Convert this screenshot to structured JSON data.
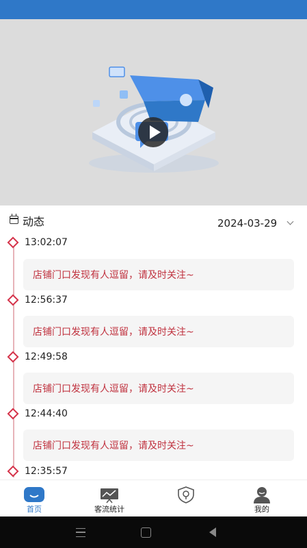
{
  "dynamics": {
    "title": "动态",
    "date": "2024-03-29"
  },
  "events": [
    {
      "time": "13:02:07",
      "message": "店铺门口发现有人逗留，请及时关注~"
    },
    {
      "time": "12:56:37",
      "message": "店铺门口发现有人逗留，请及时关注~"
    },
    {
      "time": "12:49:58",
      "message": "店铺门口发现有人逗留，请及时关注~"
    },
    {
      "time": "12:44:40",
      "message": "店铺门口发现有人逗留，请及时关注~"
    },
    {
      "time": "12:35:57",
      "message": ""
    }
  ],
  "tabbar": {
    "items": [
      {
        "label": "首页",
        "icon": "home-icon",
        "active": true
      },
      {
        "label": "客流统计",
        "icon": "chart-icon",
        "active": false
      },
      {
        "label": "",
        "icon": "shield-icon",
        "active": false
      },
      {
        "label": "我的",
        "icon": "user-icon",
        "active": false
      }
    ]
  },
  "colors": {
    "accent": "#2f78c8",
    "alert_text": "#c0323f",
    "timeline": "#d5334a"
  }
}
